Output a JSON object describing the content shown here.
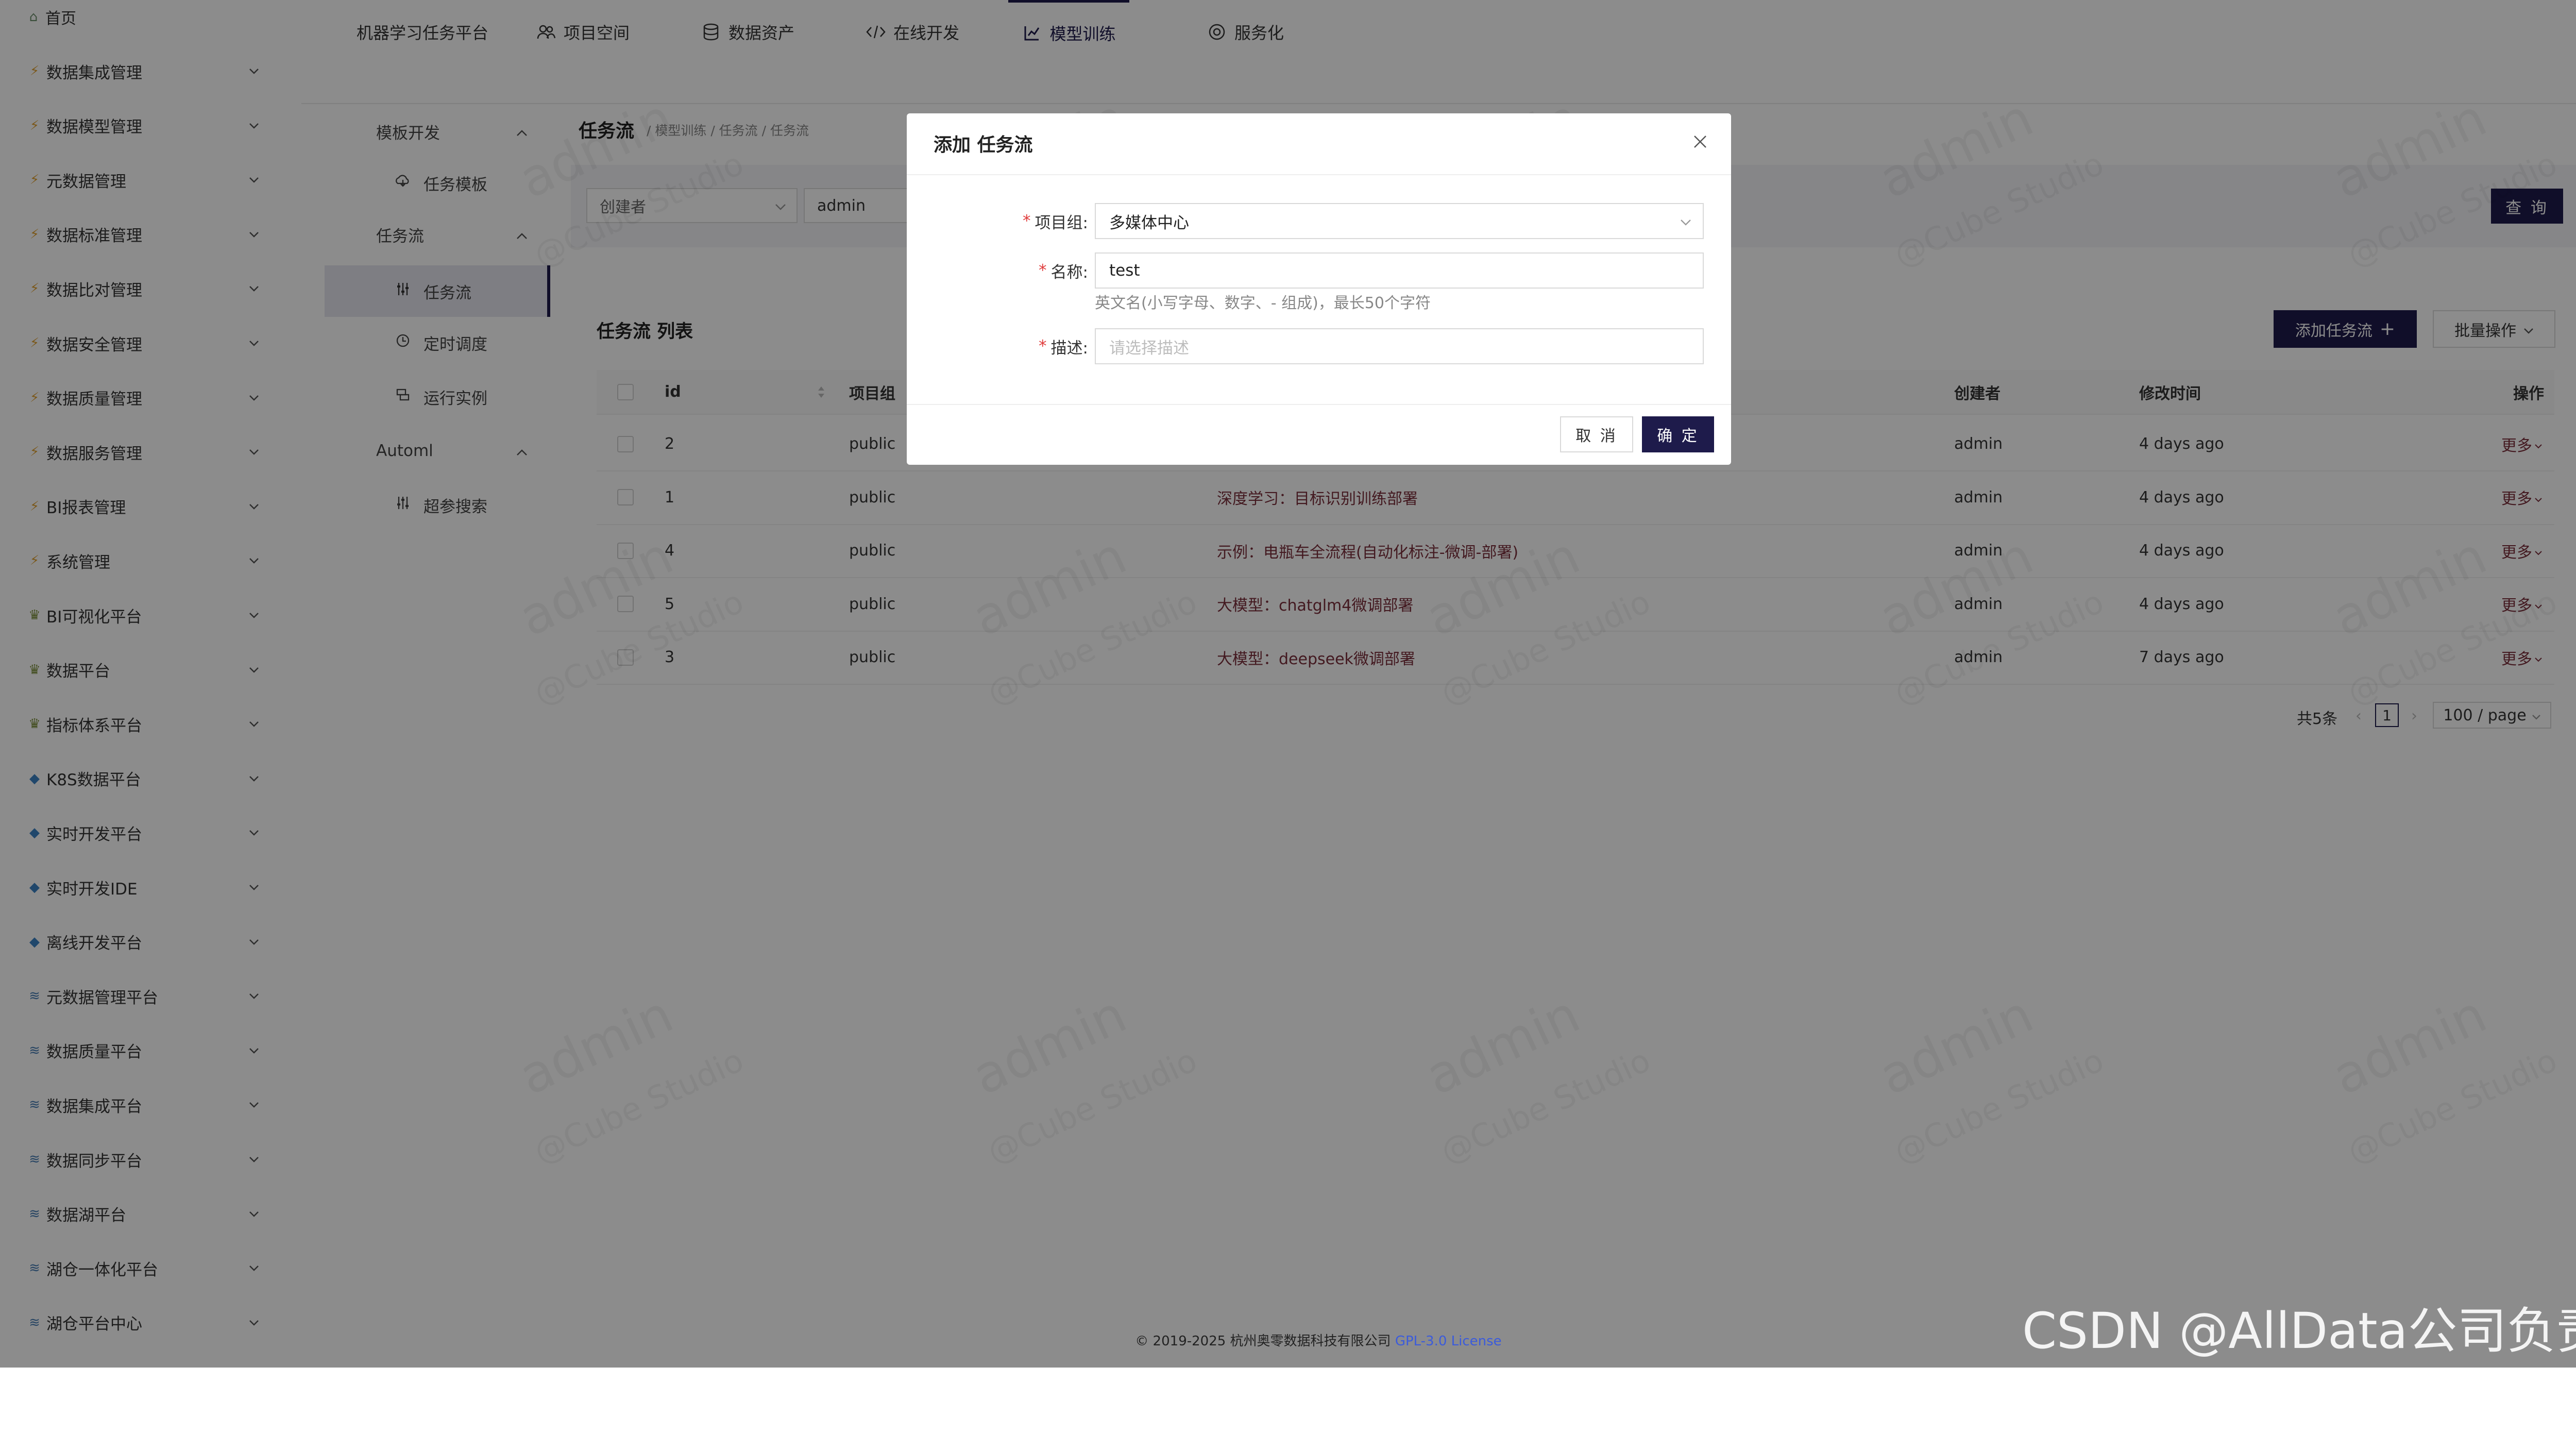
{
  "sidebar": {
    "home": "首页",
    "items": [
      {
        "label": "数据集成管理",
        "icon": "bolt-icon"
      },
      {
        "label": "数据模型管理",
        "icon": "bolt-icon"
      },
      {
        "label": "元数据管理",
        "icon": "bolt-icon"
      },
      {
        "label": "数据标准管理",
        "icon": "bolt-icon"
      },
      {
        "label": "数据比对管理",
        "icon": "bolt-icon"
      },
      {
        "label": "数据安全管理",
        "icon": "bolt-icon"
      },
      {
        "label": "数据质量管理",
        "icon": "bolt-icon"
      },
      {
        "label": "数据服务管理",
        "icon": "bolt-icon"
      },
      {
        "label": "BI报表管理",
        "icon": "bolt-icon"
      },
      {
        "label": "系统管理",
        "icon": "bolt-icon"
      },
      {
        "label": "BI可视化平台",
        "icon": "trophy-icon"
      },
      {
        "label": "数据平台",
        "icon": "trophy-icon"
      },
      {
        "label": "指标体系平台",
        "icon": "trophy-icon"
      },
      {
        "label": "K8S数据平台",
        "icon": "gem-icon"
      },
      {
        "label": "实时开发平台",
        "icon": "gem-icon"
      },
      {
        "label": "实时开发IDE",
        "icon": "gem-icon"
      },
      {
        "label": "离线开发平台",
        "icon": "gem-icon"
      },
      {
        "label": "元数据管理平台",
        "icon": "stack-icon"
      },
      {
        "label": "数据质量平台",
        "icon": "stack-icon"
      },
      {
        "label": "数据集成平台",
        "icon": "stack-icon"
      },
      {
        "label": "数据同步平台",
        "icon": "stack-icon"
      },
      {
        "label": "数据湖平台",
        "icon": "stack-icon"
      },
      {
        "label": "湖仓一体化平台",
        "icon": "stack-icon"
      },
      {
        "label": "湖仓平台中心",
        "icon": "stack-icon"
      }
    ]
  },
  "topnav": {
    "brand": "机器学习任务平台",
    "tabs": [
      {
        "label": "项目空间",
        "icon": "team-icon"
      },
      {
        "label": "数据资产",
        "icon": "database-icon"
      },
      {
        "label": "在线开发",
        "icon": "code-icon"
      },
      {
        "label": "模型训练",
        "icon": "model-icon",
        "active": true
      },
      {
        "label": "服务化",
        "icon": "service-icon"
      }
    ]
  },
  "submenu": {
    "groups": [
      {
        "label": "模板开发",
        "items": [
          {
            "label": "任务模板",
            "icon": "template-icon"
          }
        ]
      },
      {
        "label": "任务流",
        "items": [
          {
            "label": "任务流",
            "icon": "flow-icon",
            "active": true
          },
          {
            "label": "定时调度",
            "icon": "clock-icon"
          },
          {
            "label": "运行实例",
            "icon": "instance-icon"
          }
        ]
      },
      {
        "label": "Automl",
        "items": [
          {
            "label": "超参搜索",
            "icon": "tune-icon"
          }
        ]
      }
    ]
  },
  "page": {
    "title": "任务流",
    "breadcrumb": "/ 模型训练 / 任务流 / 任务流",
    "filter_field": "创建者",
    "filter_value": "admin",
    "query_label": "查 询",
    "list_title": "任务流 列表",
    "add_label": "添加任务流",
    "batch_label": "批量操作"
  },
  "table": {
    "columns": [
      "id",
      "项目组",
      "创建者",
      "修改时间",
      "操作"
    ],
    "rows": [
      {
        "id": "2",
        "group": "public",
        "name": "",
        "creator": "admin",
        "modified": "4 days ago",
        "action": "更多"
      },
      {
        "id": "1",
        "group": "public",
        "name": "深度学习：目标识别训练部署",
        "creator": "admin",
        "modified": "4 days ago",
        "action": "更多"
      },
      {
        "id": "4",
        "group": "public",
        "name": "示例：电瓶车全流程(自动化标注-微调-部署)",
        "creator": "admin",
        "modified": "4 days ago",
        "action": "更多"
      },
      {
        "id": "5",
        "group": "public",
        "name": "大模型：chatglm4微调部署",
        "creator": "admin",
        "modified": "4 days ago",
        "action": "更多"
      },
      {
        "id": "3",
        "group": "public",
        "name": "大模型：deepseek微调部署",
        "creator": "admin",
        "modified": "7 days ago",
        "action": "更多"
      }
    ]
  },
  "pagination": {
    "total": "共5条",
    "current": "1",
    "page_size": "100 / page"
  },
  "watermark": {
    "main": "admin",
    "sub": "@Cube Studio"
  },
  "footer": {
    "copyright": "© 2019-2025 杭州奥零数据科技有限公司",
    "license": "GPL-3.0 License"
  },
  "csdn": "CSDN @AllData公司负责人",
  "modal": {
    "title": "添加 任务流",
    "fields": {
      "project_label": "项目组:",
      "project_value": "多媒体中心",
      "name_label": "名称:",
      "name_value": "test",
      "name_hint": "英文名(小写字母、数字、- 组成)，最长50个字符",
      "desc_label": "描述:",
      "desc_placeholder": "请选择描述"
    },
    "cancel": "取 消",
    "ok": "确 定"
  },
  "colors": {
    "primary": "#1e1b4b",
    "link": "#7b2e3b",
    "required": "#e03c3c",
    "overlay": "rgba(0,0,0,0.45)"
  }
}
